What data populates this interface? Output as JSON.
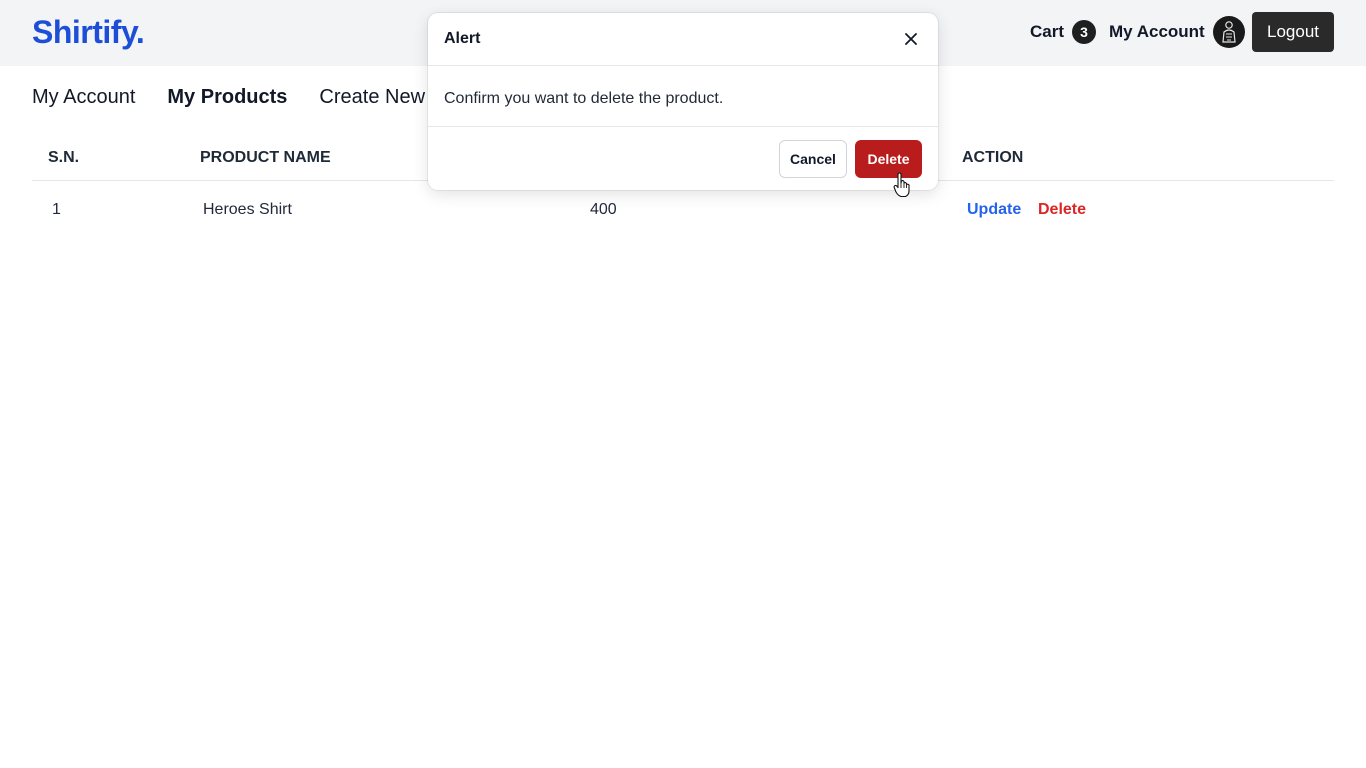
{
  "header": {
    "logo": "Shirtify.",
    "cart_label": "Cart",
    "cart_count": "3",
    "account_label": "My Account",
    "logout_label": "Logout"
  },
  "subnav": {
    "items": [
      {
        "label": "My Account",
        "active": false
      },
      {
        "label": "My Products",
        "active": true
      },
      {
        "label": "Create New",
        "active": false
      }
    ]
  },
  "table": {
    "headers": [
      "S.N.",
      "PRODUCT NAME",
      "",
      "ACTION"
    ],
    "rows": [
      {
        "sn": "1",
        "name": "Heroes Shirt",
        "price": "400",
        "update": "Update",
        "delete": "Delete"
      }
    ]
  },
  "modal": {
    "title": "Alert",
    "message": "Confirm you want to delete the product.",
    "cancel_label": "Cancel",
    "delete_label": "Delete"
  },
  "colors": {
    "brand": "#1d4ed8",
    "danger": "#b91c1c",
    "link": "#2563eb"
  }
}
